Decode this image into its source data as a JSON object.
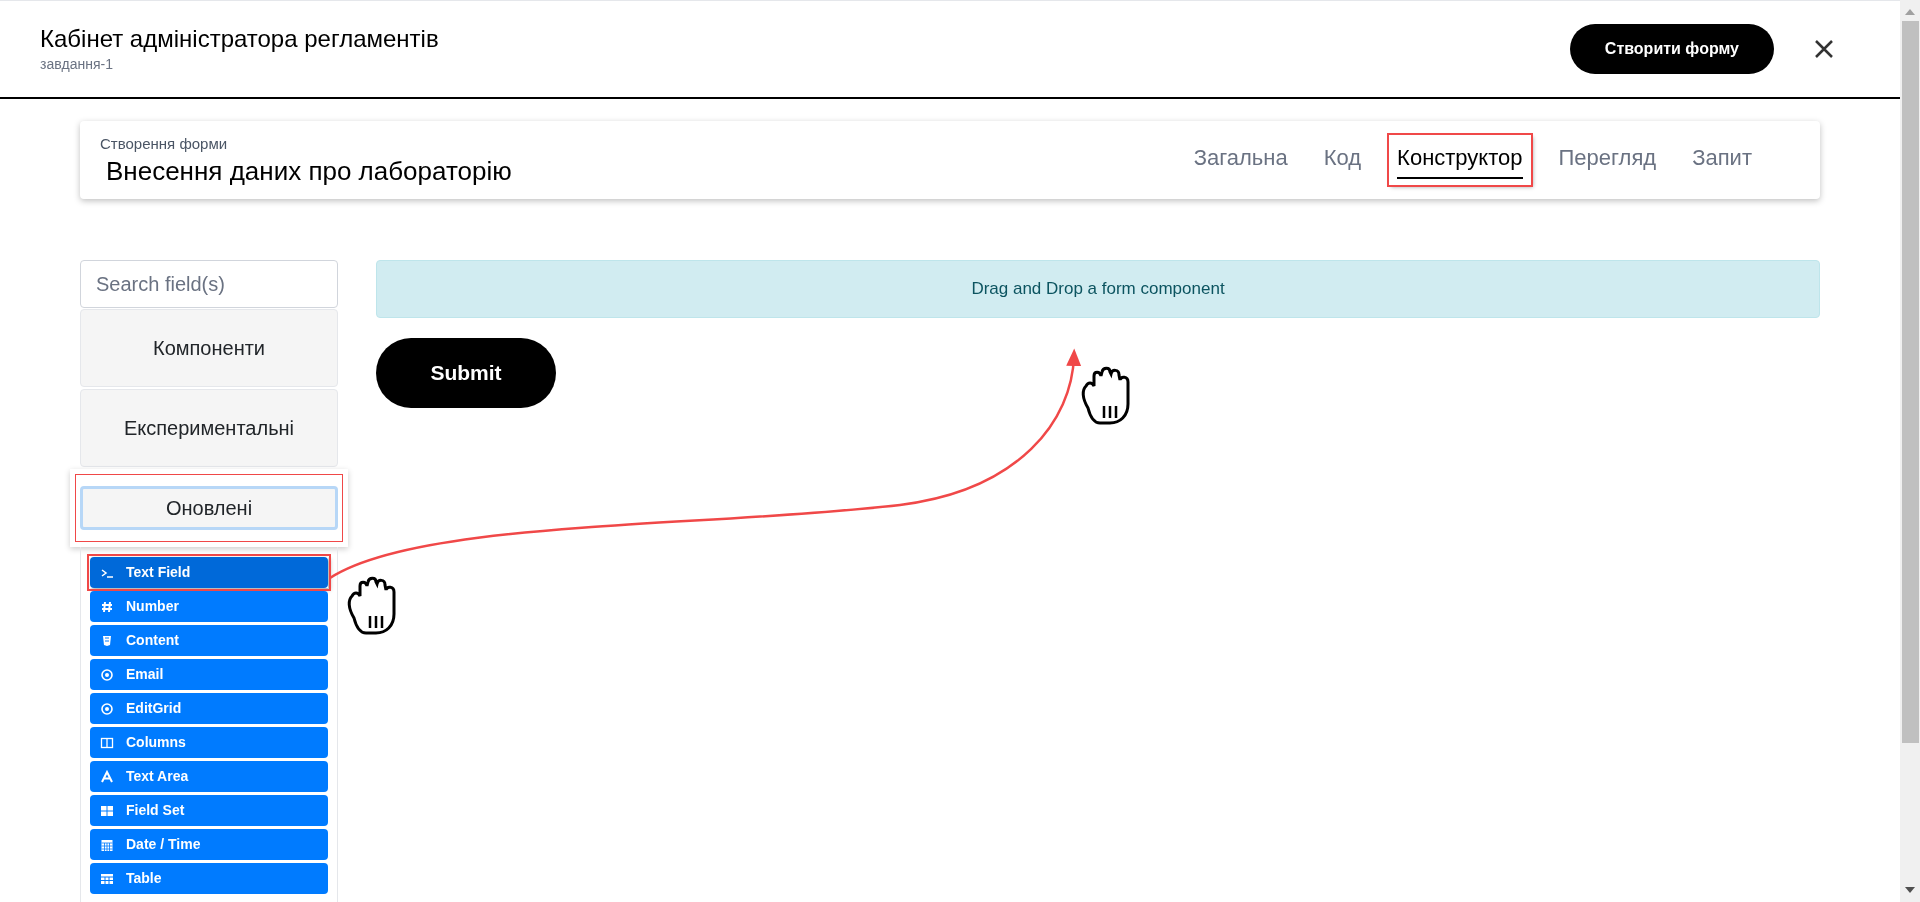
{
  "header": {
    "title": "Кабінет адміністратора регламентів",
    "subtitle": "завдання-1",
    "create_button": "Створити форму"
  },
  "form_card": {
    "caption": "Створення форми",
    "title": "Внесення даних про лабораторію"
  },
  "tabs": [
    {
      "label": "Загальна",
      "selected": false,
      "annotated": false
    },
    {
      "label": "Код",
      "selected": false,
      "annotated": false
    },
    {
      "label": "Конструктор",
      "selected": true,
      "annotated": true
    },
    {
      "label": "Перегляд",
      "selected": false,
      "annotated": false
    },
    {
      "label": "Запит",
      "selected": false,
      "annotated": false
    }
  ],
  "sidebar": {
    "search": {
      "placeholder": "Search field(s)"
    },
    "groups": [
      {
        "label": "Компоненти",
        "selected": false,
        "annotated": false
      },
      {
        "label": "Експериментальні",
        "selected": false,
        "annotated": false
      },
      {
        "label": "Оновлені",
        "selected": true,
        "annotated": true
      }
    ],
    "items": [
      {
        "label": "Text Field",
        "annotated": true
      },
      {
        "label": "Number",
        "annotated": false
      },
      {
        "label": "Content",
        "annotated": false
      },
      {
        "label": "Email",
        "annotated": false
      },
      {
        "label": "EditGrid",
        "annotated": false
      },
      {
        "label": "Columns",
        "annotated": false
      },
      {
        "label": "Text Area",
        "annotated": false
      },
      {
        "label": "Field Set",
        "annotated": false
      },
      {
        "label": "Date / Time",
        "annotated": false
      },
      {
        "label": "Table",
        "annotated": false
      }
    ]
  },
  "canvas": {
    "drop_hint": "Drag and Drop a form component",
    "submit_button": "Submit"
  }
}
